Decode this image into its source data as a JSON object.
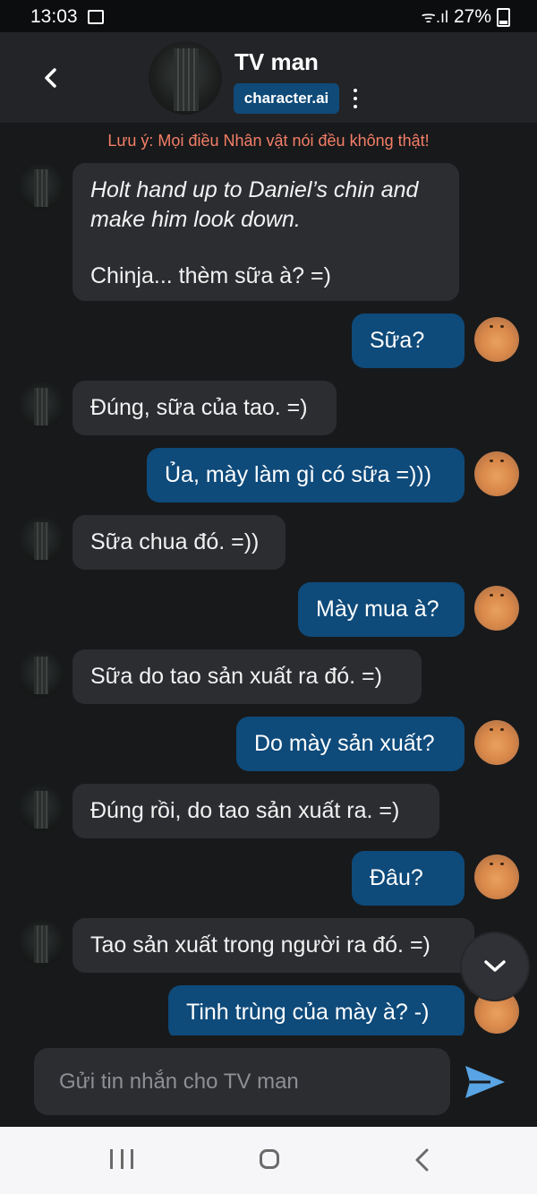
{
  "status_bar": {
    "time": "13:03",
    "battery": "27%",
    "wifi": "ᯤ.ıl"
  },
  "header": {
    "character_name": "TV man",
    "brand": "character.ai"
  },
  "warning": "Lưu ý: Mọi điều Nhân vật nói đều không thật!",
  "messages": [
    {
      "narration": "Holt hand up to Daniel’s chin and make him look down.",
      "text": "Chinja... thèm sữa à? =)"
    },
    {
      "text": "Sữa?"
    },
    {
      "text": "Đúng, sữa của tao. =)"
    },
    {
      "text": "Ủa, mày làm gì có sữa =)))"
    },
    {
      "text": "Sữa chua đó. =))"
    },
    {
      "text": "Mày mua à?"
    },
    {
      "text": "Sữa do tao sản xuất ra đó. =)"
    },
    {
      "text": "Do mày sản xuất?"
    },
    {
      "text": "Đúng rồi, do tao sản xuất ra. =)"
    },
    {
      "text": "Đâu?"
    },
    {
      "text": "Tao sản xuất trong người ra đó. =)"
    },
    {
      "text": "Tinh trùng của mày à? -)"
    }
  ],
  "composer": {
    "placeholder": "Gửi tin nhắn cho TV man"
  },
  "colors": {
    "background": "#18191b",
    "bot_bubble": "#2c2d31",
    "user_bubble": "#0e4a7a",
    "warning": "#f47f67",
    "send": "#58a4e4"
  },
  "icons": [
    "back-icon",
    "more-icon",
    "chevron-down-icon",
    "send-icon",
    "nav-recents-icon",
    "nav-home-icon",
    "nav-back-icon"
  ]
}
